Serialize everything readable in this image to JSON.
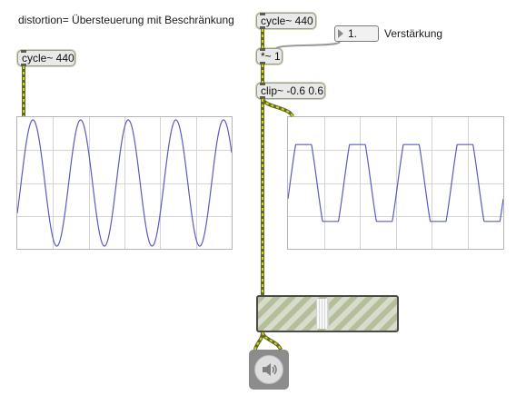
{
  "comment_title": "distortion= Übersteuerung mit Beschränkung",
  "objects": {
    "cycle_left": "cycle~ 440",
    "cycle_right": "cycle~ 440",
    "mult": "*~ 1",
    "clip": "clip~ -0.6 0.6"
  },
  "number_box": {
    "value": "1.",
    "label": "Verstärkung"
  },
  "scope_left": {
    "signal": "sine",
    "cycles_visible": 4.5
  },
  "scope_right": {
    "signal": "clipped-sine",
    "clip_low": -0.6,
    "clip_high": 0.6,
    "cycles_visible": 4
  },
  "gain_slider": {
    "level": 0.3
  },
  "dac": {
    "icon": "speaker-icon"
  },
  "colors": {
    "signal_patchcord": "#c8d400",
    "waveform": "#5b5bbf",
    "object_bg": "#e9e9e9",
    "grid": "#d4d4d4"
  }
}
